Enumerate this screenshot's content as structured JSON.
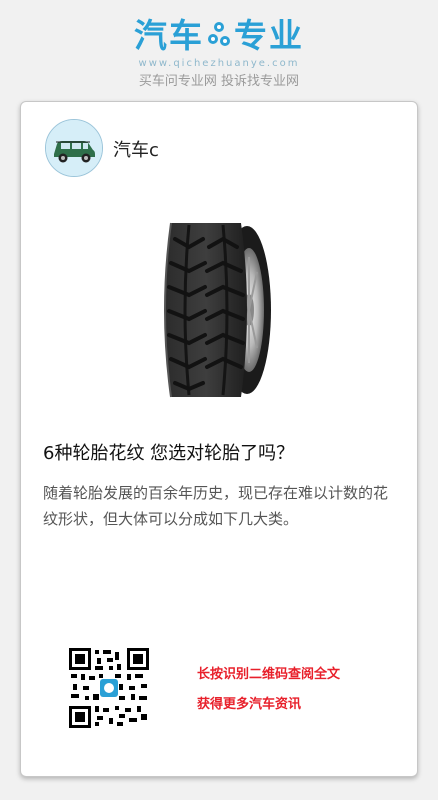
{
  "header": {
    "logo_left": "汽车",
    "logo_right": "专业",
    "domain": "www.qichezhuanye.com",
    "slogan": "买车问专业网 投诉找专业网"
  },
  "author": {
    "name": "汽车c"
  },
  "article": {
    "title": "6种轮胎花纹  您选对轮胎了吗？",
    "summary": "随着轮胎发展的百余年历史，现已存在难以计数的花纹形状，但大体可以分成如下几大类。"
  },
  "footer": {
    "qr_line1": "长按识别二维码查阅全文",
    "qr_line2": "获得更多汽车资讯"
  },
  "colors": {
    "brand": "#2aa0d6",
    "accent_red": "#e8202b"
  },
  "icons": [
    "gear-icon",
    "car-avatar-icon",
    "tire-image",
    "qr-code-image"
  ]
}
